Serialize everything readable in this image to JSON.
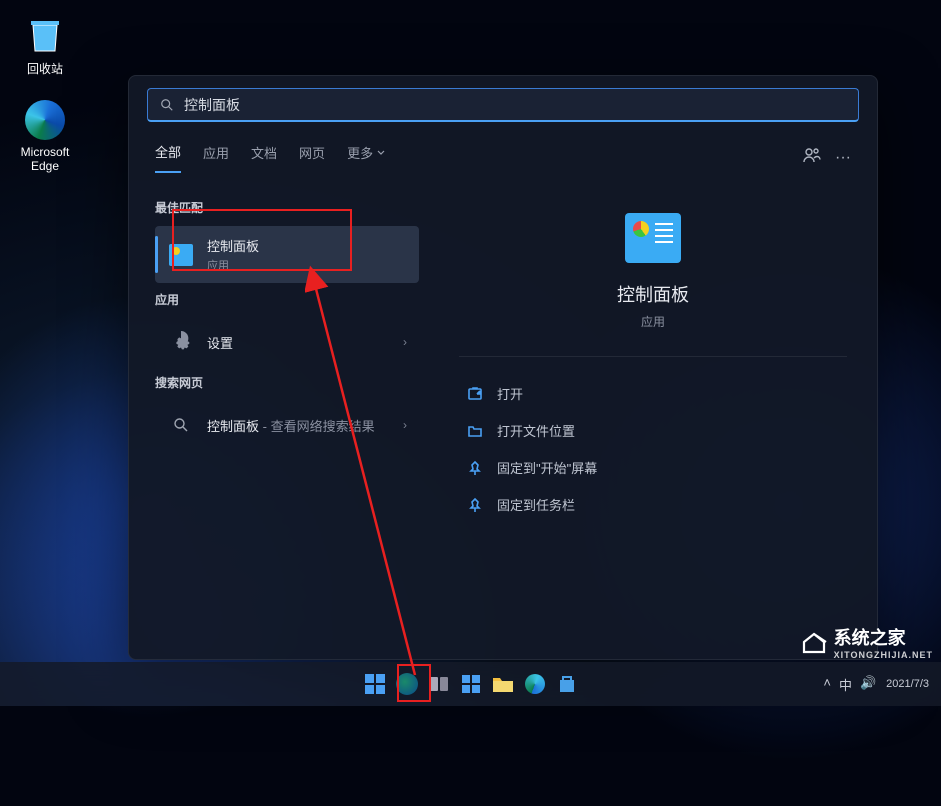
{
  "desktop": {
    "recycle_label": "回收站",
    "edge_label": "Microsoft Edge"
  },
  "search": {
    "query": "控制面板",
    "tabs": [
      "全部",
      "应用",
      "文档",
      "网页",
      "更多"
    ],
    "sections": {
      "best_match": "最佳匹配",
      "apps": "应用",
      "web": "搜索网页"
    },
    "best_result": {
      "title": "控制面板",
      "sub": "应用"
    },
    "app_result": {
      "title": "设置"
    },
    "web_result": {
      "title": "控制面板",
      "sub": " - 查看网络搜索结果"
    },
    "detail": {
      "title": "控制面板",
      "sub": "应用"
    },
    "actions": [
      "打开",
      "打开文件位置",
      "固定到\"开始\"屏幕",
      "固定到任务栏"
    ]
  },
  "taskbar": {
    "time": "2021/7/3"
  },
  "watermark": {
    "title": "系统之家",
    "sub": "XITONGZHIJIA.NET"
  }
}
